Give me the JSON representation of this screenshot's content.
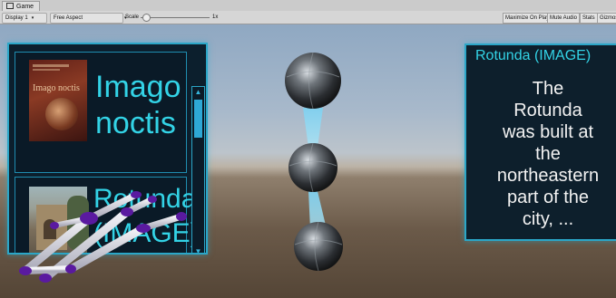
{
  "window": {
    "tab_title": "Game",
    "tab_icon": "game-view-icon"
  },
  "toolbar": {
    "display": "Display 1",
    "aspect": "Free Aspect",
    "scale_label": "Scale",
    "scale_value": "1x",
    "buttons": {
      "maximize": "Maximize On Play",
      "mute": "Mute Audio",
      "stats": "Stats",
      "gizmos": "Gizmos"
    }
  },
  "left_panel": {
    "items": [
      {
        "cover_title": "Imago noctis",
        "title_line1": "Imago",
        "title_line2": "noctis"
      },
      {
        "title_line1": "Rotunda",
        "title_line2": "(IMAGE)"
      }
    ],
    "scroll_up": "▲",
    "scroll_down": "▼",
    "scroll_position": 0.05
  },
  "right_panel": {
    "header": "Rotunda (IMAGE)",
    "body_lines": [
      "The",
      "Rotunda",
      "was built at",
      "the",
      "northeastern",
      "part of the",
      "city, ..."
    ]
  },
  "colors": {
    "accent": "#33d3e6",
    "panel_bg": "#0c1f2d",
    "panel_border": "#2ba6c7",
    "hand_purple": "#5a1aa0"
  }
}
